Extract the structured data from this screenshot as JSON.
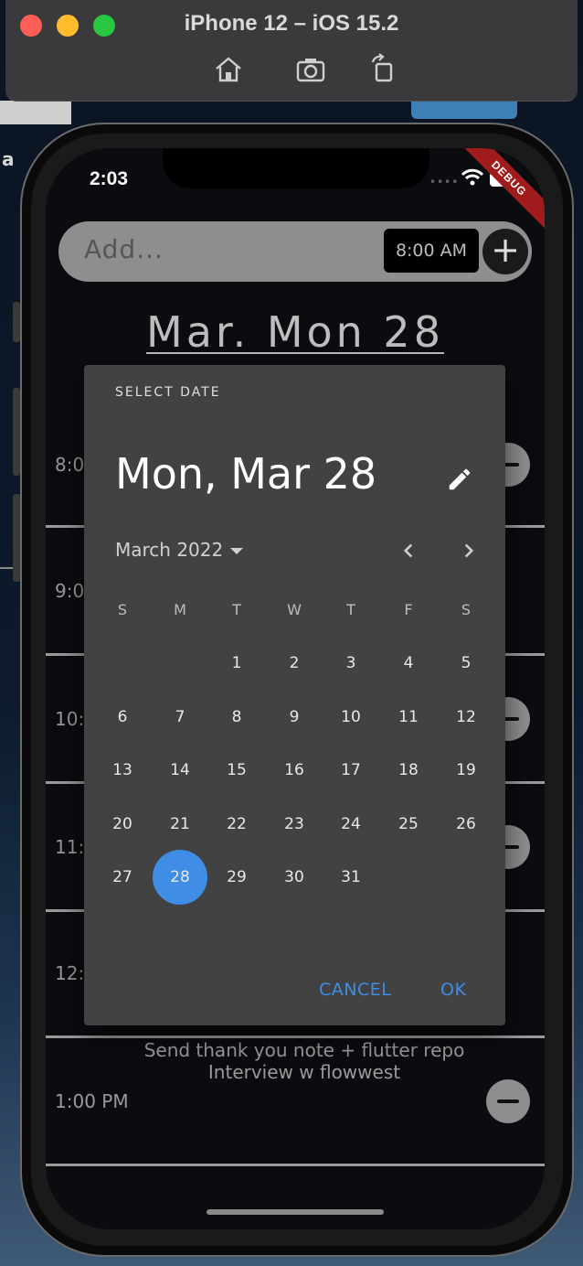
{
  "simulator": {
    "title": "iPhone 12 – iOS 15.2",
    "icons": [
      "home-icon",
      "screenshot-icon",
      "rotate-icon"
    ]
  },
  "background": {
    "side_letter": "a"
  },
  "status_bar": {
    "time": "2:03",
    "debug_label": "DEBUG"
  },
  "app": {
    "add_placeholder": "Add...",
    "time_button": "8:00 AM",
    "add_icon": "+",
    "date_heading": "Mar. Mon 28",
    "timeline": [
      {
        "label": "8:0",
        "has_remove": true
      },
      {
        "label": "9:0",
        "has_remove": false
      },
      {
        "label": "10:(",
        "has_remove": true
      },
      {
        "label": "11:(",
        "has_remove": true
      },
      {
        "label": "12:(",
        "has_remove": false
      },
      {
        "label": "1:00 PM",
        "has_remove": true,
        "tasks": [
          "Send thank you note + flutter repo",
          "Interview w flowwest"
        ]
      }
    ]
  },
  "dialog": {
    "help_text": "SELECT DATE",
    "selected_date_text": "Mon, Mar 28",
    "month_year": "March 2022",
    "weekdays": [
      "S",
      "M",
      "T",
      "W",
      "T",
      "F",
      "S"
    ],
    "first_weekday_index": 2,
    "days_in_month": 31,
    "selected_day": 28,
    "cancel_label": "CANCEL",
    "ok_label": "OK",
    "accent_color": "#3f8de4"
  },
  "colors": {
    "dialog_bg": "#424242",
    "screen_bg": "#0b0c10",
    "accent": "#3f8de4",
    "debug_ribbon": "#a01b1b"
  }
}
